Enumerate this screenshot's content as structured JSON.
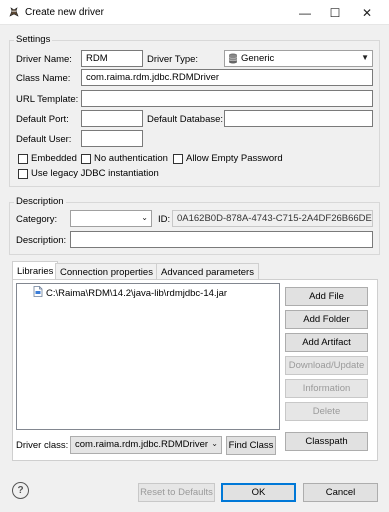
{
  "window": {
    "title": "Create new driver",
    "minimize_glyph": "—",
    "maximize_glyph": "☐",
    "close_glyph": "✕"
  },
  "settings": {
    "group_label": "Settings",
    "driver_name_label": "Driver Name:",
    "driver_name_value": "RDM",
    "driver_type_label": "Driver Type:",
    "driver_type_value": "Generic",
    "class_name_label": "Class Name:",
    "class_name_value": "com.raima.rdm.jdbc.RDMDriver",
    "url_template_label": "URL Template:",
    "url_template_value": "",
    "default_port_label": "Default Port:",
    "default_port_value": "",
    "default_database_label": "Default Database:",
    "default_database_value": "",
    "default_user_label": "Default User:",
    "default_user_value": "",
    "embedded_label": "Embedded",
    "no_auth_label": "No authentication",
    "allow_empty_pw_label": "Allow Empty Password",
    "legacy_jdbc_label": "Use legacy JDBC instantiation"
  },
  "description": {
    "group_label": "Description",
    "category_label": "Category:",
    "category_value": "",
    "id_label": "ID:",
    "id_value": "0A162B0D-878A-4743-C715-2A4DF26B66DE",
    "description_label": "Description:",
    "description_value": ""
  },
  "tabs": [
    {
      "label": "Libraries"
    },
    {
      "label": "Connection properties"
    },
    {
      "label": "Advanced parameters"
    }
  ],
  "libraries": {
    "items": [
      {
        "path": "C:\\Raima\\RDM\\14.2\\java-lib\\rdmjdbc-14.jar"
      }
    ],
    "buttons": {
      "add_file": "Add File",
      "add_folder": "Add Folder",
      "add_artifact": "Add Artifact",
      "download_update": "Download/Update",
      "information": "Information",
      "delete": "Delete",
      "classpath": "Classpath"
    },
    "driver_class_label": "Driver class:",
    "driver_class_value": "com.raima.rdm.jdbc.RDMDriver",
    "find_class": "Find Class"
  },
  "footer": {
    "help_glyph": "?",
    "reset_defaults": "Reset to Defaults",
    "ok": "OK",
    "cancel": "Cancel"
  },
  "colors": {
    "accent": "#0078d7",
    "dialog_bg": "#f0f0f0",
    "disabled_text": "#9a9a9a"
  }
}
